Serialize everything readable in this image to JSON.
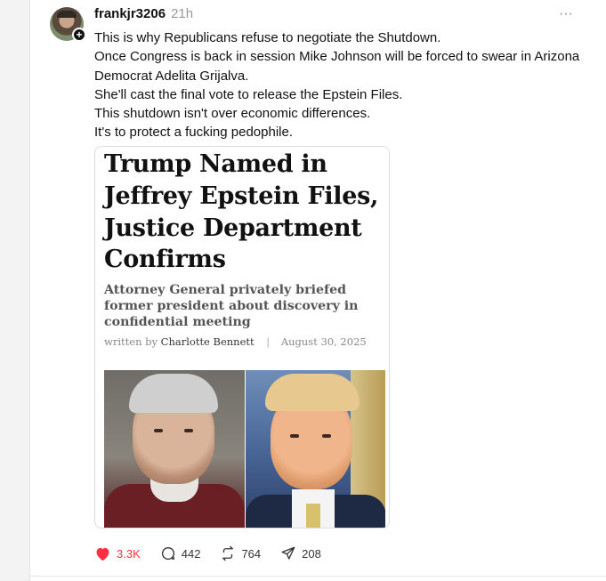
{
  "post": {
    "username": "frankjr3206",
    "time": "21h",
    "more_label": "···",
    "follow_badge": "+",
    "text_lines": [
      "This is why Republicans refuse to negotiate the Shutdown.",
      "Once Congress is back in session Mike Johnson will be forced to swear in Arizona",
      "Democrat Adelita Grijalva.",
      "She'll cast the final vote to release the Epstein Files.",
      "This shutdown isn't over economic differences.",
      "It's to protect a fucking pedophile."
    ]
  },
  "article": {
    "headline_lines": [
      "Trump Named in",
      "Jeffrey Epstein Files,",
      "Justice Department",
      "Confirms"
    ],
    "deck_lines": [
      "Attorney General privately briefed",
      "former president about discovery in",
      "confidential meeting"
    ],
    "byline_prefix": "written by",
    "author": "Charlotte Bennett",
    "separator": "|",
    "date": "August 30, 2025"
  },
  "actions": {
    "likes": "3.3K",
    "comments": "442",
    "reposts": "764",
    "shares": "208"
  },
  "colors": {
    "like_active": "#ff3040",
    "text": "#111111",
    "muted": "#999999"
  }
}
